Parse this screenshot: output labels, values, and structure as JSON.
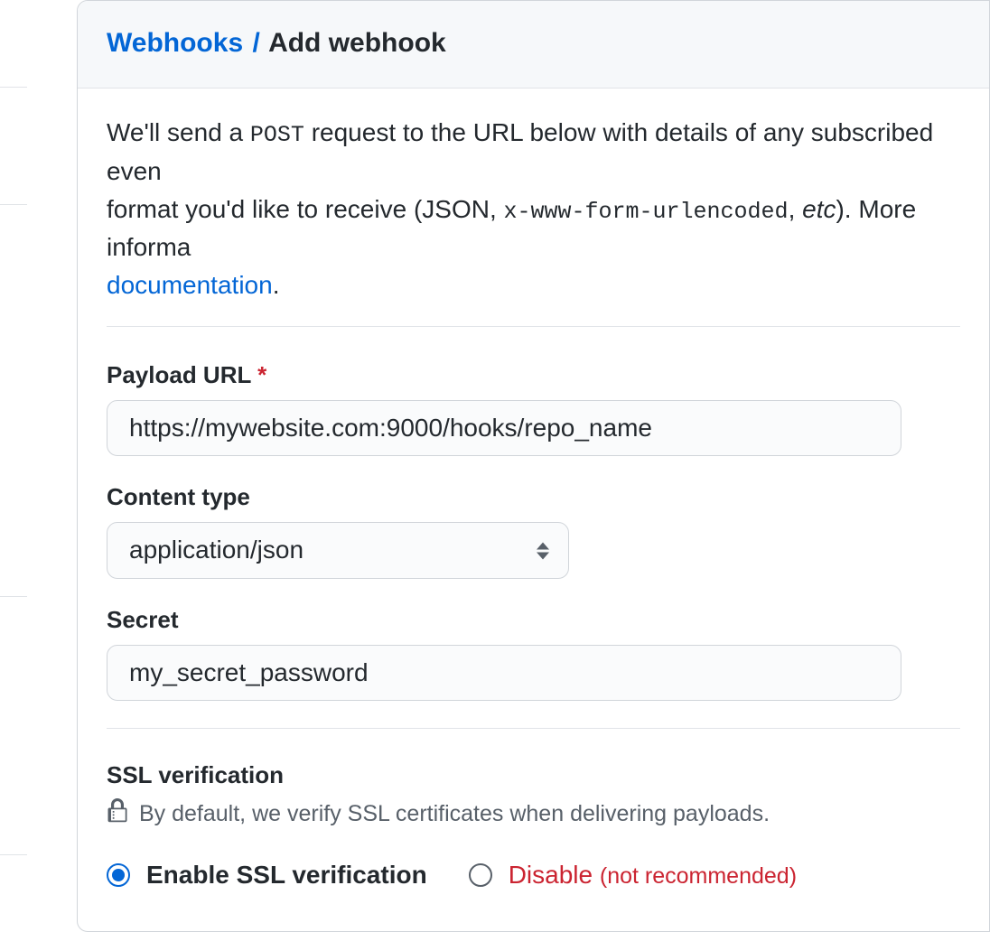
{
  "breadcrumb": {
    "parent": "Webhooks",
    "separator": "/",
    "current": "Add webhook"
  },
  "intro": {
    "part1": "We'll send a ",
    "code1": "POST",
    "part2": " request to the URL below with details of any subscribed even",
    "part3": "format you'd like to receive (JSON, ",
    "code2": "x-www-form-urlencoded",
    "part4": ", ",
    "em1": "etc",
    "part5": "). More informa",
    "doc_link": "documentation",
    "period": "."
  },
  "form": {
    "payload_url": {
      "label": "Payload URL",
      "required": "*",
      "value": "https://mywebsite.com:9000/hooks/repo_name"
    },
    "content_type": {
      "label": "Content type",
      "value": "application/json"
    },
    "secret": {
      "label": "Secret",
      "value": "my_secret_password"
    }
  },
  "ssl": {
    "title": "SSL verification",
    "note": "By default, we verify SSL certificates when delivering payloads.",
    "enable_label": "Enable SSL verification",
    "disable_label": "Disable",
    "disable_note": "(not recommended)"
  }
}
